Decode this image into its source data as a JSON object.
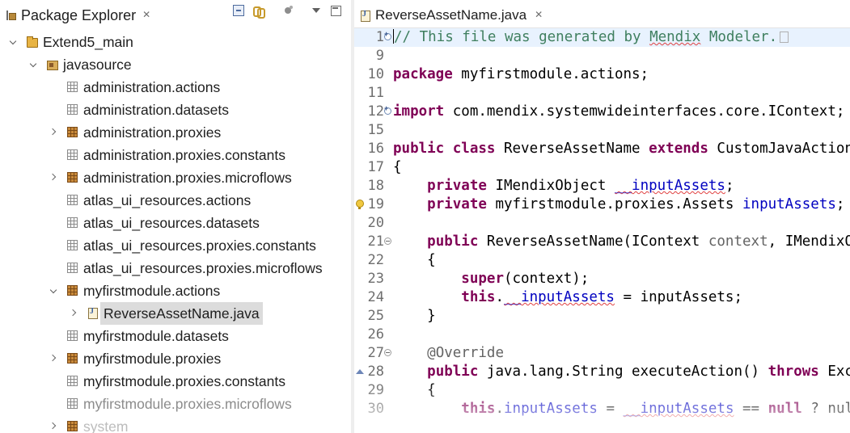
{
  "package_explorer": {
    "title": "Package Explorer",
    "close_glyph": "✕",
    "toolbar_icons": [
      "collapse-all-icon",
      "link-with-editor-icon",
      "focus-on-active-task-icon",
      "view-menu-icon",
      "minimize-icon"
    ],
    "tree": [
      {
        "label": "Extend5_main",
        "icon": "java-project-icon",
        "twisty": "open",
        "level": 0
      },
      {
        "label": "javasource",
        "icon": "source-folder-icon",
        "twisty": "open",
        "level": 1
      },
      {
        "label": "administration.actions",
        "icon": "empty-package-icon",
        "twisty": "none",
        "level": 2
      },
      {
        "label": "administration.datasets",
        "icon": "empty-package-icon",
        "twisty": "none",
        "level": 2
      },
      {
        "label": "administration.proxies",
        "icon": "package-icon",
        "twisty": "closed",
        "level": 2
      },
      {
        "label": "administration.proxies.constants",
        "icon": "empty-package-icon",
        "twisty": "none",
        "level": 2
      },
      {
        "label": "administration.proxies.microflows",
        "icon": "package-icon",
        "twisty": "closed",
        "level": 2
      },
      {
        "label": "atlas_ui_resources.actions",
        "icon": "empty-package-icon",
        "twisty": "none",
        "level": 2
      },
      {
        "label": "atlas_ui_resources.datasets",
        "icon": "empty-package-icon",
        "twisty": "none",
        "level": 2
      },
      {
        "label": "atlas_ui_resources.proxies.constants",
        "icon": "empty-package-icon",
        "twisty": "none",
        "level": 2
      },
      {
        "label": "atlas_ui_resources.proxies.microflows",
        "icon": "empty-package-icon",
        "twisty": "none",
        "level": 2
      },
      {
        "label": "myfirstmodule.actions",
        "icon": "package-icon",
        "twisty": "open",
        "level": 2
      },
      {
        "label": "ReverseAssetName.java",
        "icon": "java-file-icon",
        "twisty": "closed",
        "level": 3,
        "selected": true
      },
      {
        "label": "myfirstmodule.datasets",
        "icon": "empty-package-icon",
        "twisty": "none",
        "level": 2
      },
      {
        "label": "myfirstmodule.proxies",
        "icon": "package-icon",
        "twisty": "closed",
        "level": 2
      },
      {
        "label": "myfirstmodule.proxies.constants",
        "icon": "empty-package-icon",
        "twisty": "none",
        "level": 2
      },
      {
        "label": "myfirstmodule.proxies.microflows",
        "icon": "empty-package-icon",
        "twisty": "none",
        "level": 2,
        "dim": true
      },
      {
        "label": "system",
        "icon": "package-icon",
        "twisty": "closed",
        "level": 2,
        "faint": true
      }
    ]
  },
  "editor": {
    "tab_label": "ReverseAssetName.java",
    "close_glyph": "✕",
    "lines": [
      {
        "num": "1",
        "gutter": "expand",
        "segments": [
          {
            "t": "// This file was generated by ",
            "c": "cmt"
          },
          {
            "t": "Mendix",
            "c": "cmt squig"
          },
          {
            "t": " Modeler.",
            "c": "cmt"
          }
        ],
        "current": true,
        "caret": true,
        "folded": true
      },
      {
        "num": "9",
        "segments": []
      },
      {
        "num": "10",
        "segments": [
          {
            "t": "package",
            "c": "kw"
          },
          {
            "t": " myfirstmodule.actions;",
            "c": ""
          }
        ]
      },
      {
        "num": "11",
        "segments": []
      },
      {
        "num": "12",
        "gutter": "expand",
        "segments": [
          {
            "t": "import",
            "c": "kw"
          },
          {
            "t": " com.mendix.systemwideinterfaces.core.IContext;",
            "c": ""
          }
        ]
      },
      {
        "num": "15",
        "segments": []
      },
      {
        "num": "16",
        "segments": [
          {
            "t": "public",
            "c": "kw"
          },
          {
            "t": " ",
            "c": ""
          },
          {
            "t": "class",
            "c": "kw"
          },
          {
            "t": " ReverseAssetName ",
            "c": ""
          },
          {
            "t": "extends",
            "c": "kw"
          },
          {
            "t": " CustomJavaAction<String>",
            "c": ""
          }
        ]
      },
      {
        "num": "17",
        "segments": [
          {
            "t": "{",
            "c": ""
          }
        ]
      },
      {
        "num": "18",
        "segments": [
          {
            "t": "    ",
            "c": ""
          },
          {
            "t": "private",
            "c": "kw"
          },
          {
            "t": " IMendixObject ",
            "c": ""
          },
          {
            "t": "__inputAssets",
            "c": "fld squig"
          },
          {
            "t": ";",
            "c": ""
          }
        ]
      },
      {
        "num": "19",
        "marker": "warning",
        "segments": [
          {
            "t": "    ",
            "c": ""
          },
          {
            "t": "private",
            "c": "kw"
          },
          {
            "t": " myfirstmodule.proxies.Assets ",
            "c": ""
          },
          {
            "t": "inputAssets",
            "c": "fld"
          },
          {
            "t": ";",
            "c": ""
          }
        ]
      },
      {
        "num": "20",
        "segments": []
      },
      {
        "num": "21",
        "gutter": "fold",
        "segments": [
          {
            "t": "    ",
            "c": ""
          },
          {
            "t": "public",
            "c": "kw"
          },
          {
            "t": " ReverseAssetName(IContext ",
            "c": ""
          },
          {
            "t": "context",
            "c": "ann"
          },
          {
            "t": ", IMendixObject inputAssets)",
            "c": ""
          }
        ]
      },
      {
        "num": "22",
        "segments": [
          {
            "t": "    {",
            "c": ""
          }
        ]
      },
      {
        "num": "23",
        "segments": [
          {
            "t": "        ",
            "c": ""
          },
          {
            "t": "super",
            "c": "kw"
          },
          {
            "t": "(context);",
            "c": ""
          }
        ]
      },
      {
        "num": "24",
        "segments": [
          {
            "t": "        ",
            "c": ""
          },
          {
            "t": "this",
            "c": "kw"
          },
          {
            "t": ".",
            "c": ""
          },
          {
            "t": "__inputAssets",
            "c": "fld squig"
          },
          {
            "t": " = inputAssets;",
            "c": ""
          }
        ]
      },
      {
        "num": "25",
        "segments": [
          {
            "t": "    }",
            "c": ""
          }
        ]
      },
      {
        "num": "26",
        "segments": []
      },
      {
        "num": "27",
        "gutter": "fold",
        "segments": [
          {
            "t": "    ",
            "c": ""
          },
          {
            "t": "@Override",
            "c": "ann"
          }
        ]
      },
      {
        "num": "28",
        "marker": "override",
        "segments": [
          {
            "t": "    ",
            "c": ""
          },
          {
            "t": "public",
            "c": "kw"
          },
          {
            "t": " java.lang.String executeAction() ",
            "c": ""
          },
          {
            "t": "throws",
            "c": "kw"
          },
          {
            "t": " Exception",
            "c": ""
          }
        ]
      },
      {
        "num": "29",
        "segments": [
          {
            "t": "    {",
            "c": ""
          }
        ]
      },
      {
        "num": "30",
        "segments": [
          {
            "t": "        ",
            "c": ""
          },
          {
            "t": "this",
            "c": "kw"
          },
          {
            "t": ".",
            "c": ""
          },
          {
            "t": "inputAssets",
            "c": "fld"
          },
          {
            "t": " = ",
            "c": ""
          },
          {
            "t": "__inputAssets",
            "c": "fld squig"
          },
          {
            "t": " == ",
            "c": ""
          },
          {
            "t": "null",
            "c": "kw"
          },
          {
            "t": " ? null :",
            "c": ""
          }
        ]
      }
    ]
  },
  "colors": {
    "keyword": "#7f0055",
    "comment": "#3f7f5f",
    "field": "#0000c0",
    "annotation": "#646464",
    "current_line": "#e8f2fe",
    "selection": "#dcdcdc"
  }
}
